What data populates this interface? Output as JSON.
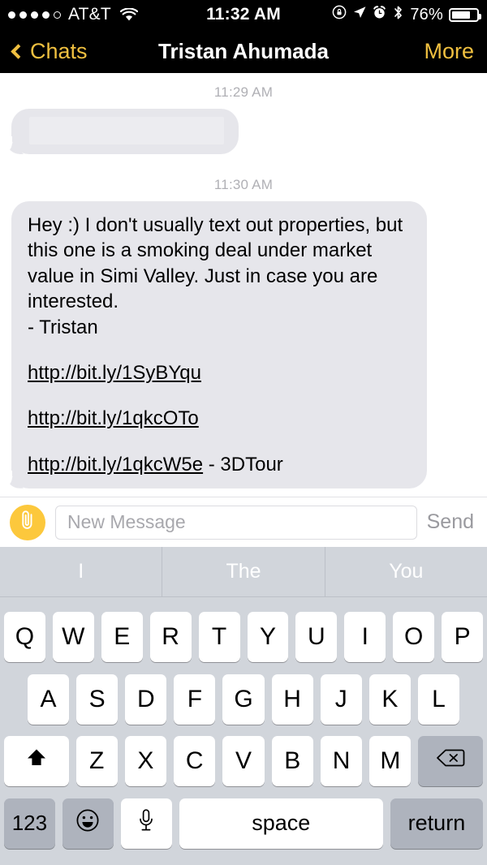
{
  "status_bar": {
    "signal_dots_filled": 4,
    "signal_dots_total": 5,
    "carrier": "AT&T",
    "wifi_icon": "wifi-icon",
    "time": "11:32 AM",
    "icons": [
      "rotation-lock-icon",
      "location-arrow-icon",
      "alarm-clock-icon",
      "bluetooth-icon"
    ],
    "battery_percent": "76%",
    "battery_level": 76
  },
  "nav_bar": {
    "back_label": "Chats",
    "back_icon": "chevron-left-icon",
    "title": "Tristan Ahumada",
    "more_label": "More",
    "accent_color": "#f0c040",
    "background_color": "#000000"
  },
  "conversation": {
    "bubble_color": "#e6e6eb",
    "messages": [
      {
        "timestamp": "11:29 AM",
        "type": "redacted",
        "text": ""
      },
      {
        "timestamp": "11:30 AM",
        "type": "text",
        "text": "Hey :) I don't usually text out properties, but this one is a smoking deal under market value in Simi Valley. Just in case you are interested.\n- Tristan",
        "links": [
          {
            "url": "http://bit.ly/1SyBYqu",
            "suffix": ""
          },
          {
            "url": "http://bit.ly/1qkcOTo",
            "suffix": ""
          },
          {
            "url": "http://bit.ly/1qkcW5e",
            "suffix": " - 3DTour"
          }
        ]
      }
    ]
  },
  "input_bar": {
    "attach_icon": "paperclip-icon",
    "attach_color": "#fcc83c",
    "placeholder": "New Message",
    "value": "",
    "send_label": "Send"
  },
  "keyboard": {
    "predictions": [
      "I",
      "The",
      "You"
    ],
    "row1": [
      "Q",
      "W",
      "E",
      "R",
      "T",
      "Y",
      "U",
      "I",
      "O",
      "P"
    ],
    "row2": [
      "A",
      "S",
      "D",
      "F",
      "G",
      "H",
      "J",
      "K",
      "L"
    ],
    "row3": [
      "Z",
      "X",
      "C",
      "V",
      "B",
      "N",
      "M"
    ],
    "shift_icon": "shift-arrow-icon",
    "backspace_icon": "backspace-icon",
    "numeric_label": "123",
    "emoji_icon": "emoji-smiley-icon",
    "mic_icon": "microphone-icon",
    "space_label": "space",
    "return_label": "return"
  }
}
